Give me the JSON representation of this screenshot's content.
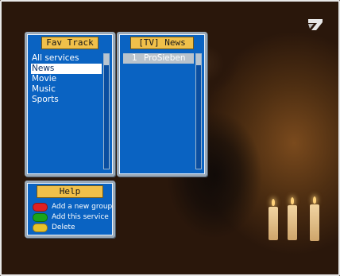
{
  "fav_panel": {
    "title": "Fav Track",
    "items": [
      {
        "label": "All services"
      },
      {
        "label": "News"
      },
      {
        "label": "Movie"
      },
      {
        "label": "Music"
      },
      {
        "label": "Sports"
      }
    ],
    "selected_index": 1
  },
  "channel_panel": {
    "title": "[TV] News",
    "items": [
      {
        "number": "1",
        "name": "ProSieben"
      }
    ]
  },
  "help_panel": {
    "title": "Help",
    "rows": [
      {
        "color_name": "red",
        "color": "#e02020",
        "label": "Add a new group"
      },
      {
        "color_name": "green",
        "color": "#1aa51a",
        "label": "Add this service"
      },
      {
        "color_name": "yellow",
        "color": "#e8c22a",
        "label": "Delete"
      }
    ]
  },
  "channel_logo": {
    "icon": "prosieben-logo-icon"
  }
}
